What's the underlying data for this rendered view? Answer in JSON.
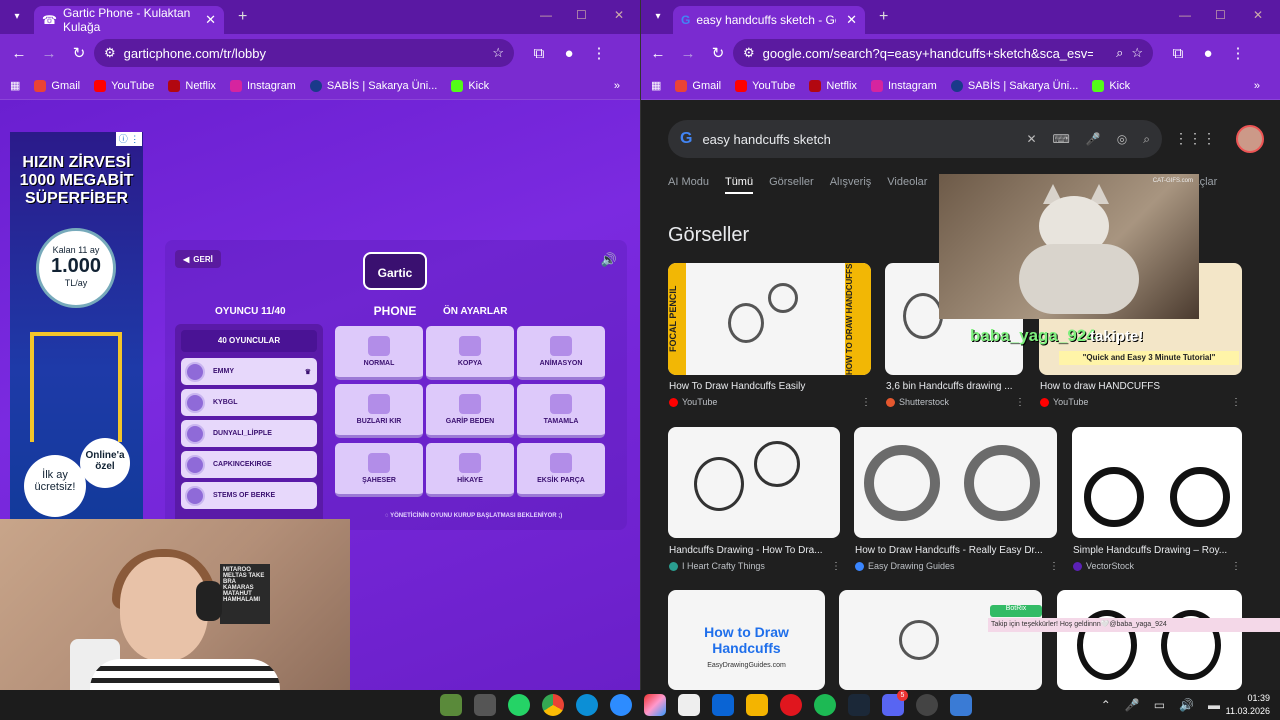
{
  "left_window": {
    "tab_title": "Gartic Phone - Kulaktan Kulağa",
    "url": "garticphone.com/tr/lobby",
    "bookmarks": [
      "Gmail",
      "YouTube",
      "Netflix",
      "Instagram",
      "SABİS | Sakarya Üni...",
      "Kick"
    ]
  },
  "right_window": {
    "tab_title": "easy handcuffs sketch - Google",
    "url": "google.com/search?q=easy+handcuffs+sketch&sca_esv=868...",
    "bookmarks": [
      "Gmail",
      "YouTube",
      "Netflix",
      "Instagram",
      "SABİS | Sakarya Üni...",
      "Kick"
    ]
  },
  "ad": {
    "headline": "HIZIN ZİRVESİ 1000 MEGABİT SÜPERFİBER",
    "price_top": "Kalan 11 ay",
    "price": "1.000",
    "price_unit": "TL/ay",
    "badge1": "Online'a özel",
    "badge2": "İlk ay ücretsiz!"
  },
  "gartic": {
    "back_label": "GERİ",
    "logo": "Gartic PHONE",
    "players_header": "OYUNCU 11/40",
    "presets_header": "ÖN AYARLAR",
    "player_count_btn": "40 OYUNCULAR",
    "players": [
      "EMMY",
      "KYBGL",
      "DUNYALI_LİPPLE",
      "CAPKINCEKIRGE",
      "STEMS OF BERKE"
    ],
    "modes": [
      "NORMAL",
      "KOPYA",
      "ANİMASYON",
      "BUZLARI KIR",
      "GARİP BEDEN",
      "TAMAMLA",
      "ŞAHESER",
      "HİKAYE",
      "EKSİK PARÇA"
    ],
    "waiting_text": "YÖNETİCİNİN OYUNU KURUP BAŞLATMASI BEKLENİYOR ;)"
  },
  "google": {
    "query": "easy handcuffs sketch",
    "tabs": [
      "AI Modu",
      "Tümü",
      "Görseller",
      "Alışveriş",
      "Videolar",
      "açlar"
    ],
    "section_title": "Görseller",
    "results": [
      {
        "caption": "How To Draw Handcuffs Easily",
        "source": "YouTube"
      },
      {
        "caption": "3,6 bin Handcuffs drawing ...",
        "source": "Shutterstock"
      },
      {
        "caption": "How to draw HANDCUFFS",
        "source": "YouTube"
      },
      {
        "caption": "Handcuffs Drawing - How To Dra...",
        "source": "I Heart Crafty Things"
      },
      {
        "caption": "How to Draw Handcuffs - Really Easy Dr...",
        "source": "Easy Drawing Guides"
      },
      {
        "caption": "Simple Handcuffs Drawing – Roy...",
        "source": "VectorStock"
      }
    ],
    "thumb_texts": {
      "focal": "FOCAL PENCIL",
      "htd": "HOW TO DRAW HANDCUFFS",
      "tutorial": "\"Quick and Easy 3 Minute Tutorial\"",
      "bottom_title": "How to Draw Handcuffs",
      "bottom_site": "EasyDrawingGuides.com"
    }
  },
  "overlay": {
    "cat_source": "CAT-GIFS.com",
    "follower": "baba_yaga_924",
    "follow_word": "takipte!",
    "bot_label": "BotRix",
    "chat_message": "Takip için teşekkürler! Hoş geldinnn🤍@baba_yaga_924"
  },
  "webcam": {
    "poster_text": "MITAROO MELTAS TAKE BRA KAMARAS MATAHUT HAMHALAMI"
  },
  "taskbar": {
    "time": "01:39",
    "date": "11.03.2026",
    "discord_badge": "5"
  }
}
